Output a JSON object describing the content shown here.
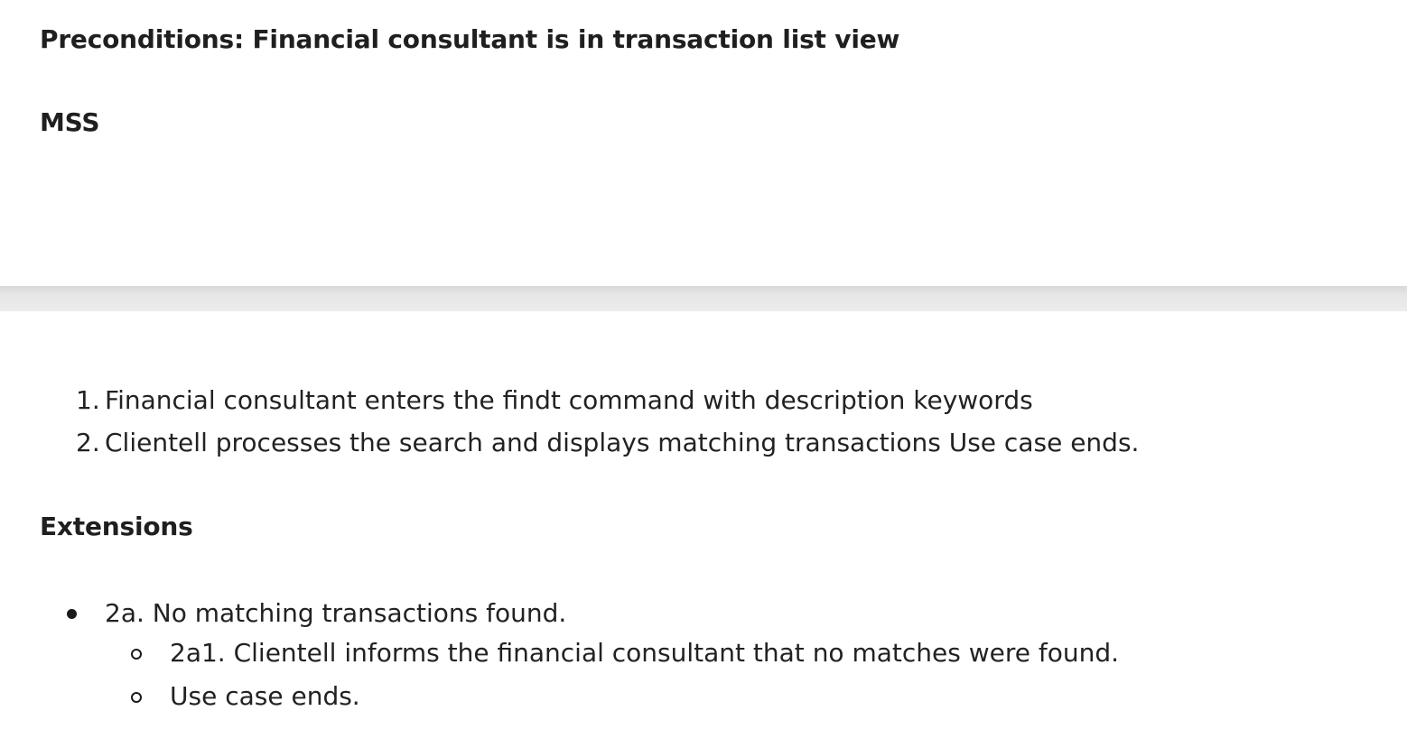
{
  "preconditions": {
    "heading": "Preconditions: Financial consultant is in transaction list view"
  },
  "mss": {
    "heading": "MSS",
    "steps": [
      {
        "number": "1.",
        "text": "Financial consultant enters the findt command with description keywords"
      },
      {
        "number": "2.",
        "text": "Clientell processes the search and displays matching transactions Use case ends."
      }
    ]
  },
  "extensions": {
    "heading": "Extensions",
    "items": [
      {
        "text": "2a. No matching transactions found.",
        "subitems": [
          "2a1. Clientell informs the financial consultant that no matches were found.",
          "Use case ends."
        ]
      }
    ]
  }
}
